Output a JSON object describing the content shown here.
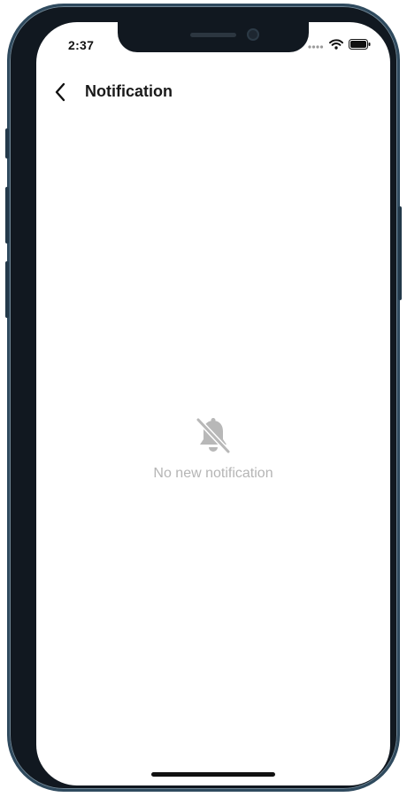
{
  "status_bar": {
    "time": "2:37",
    "icons": [
      "signal-icon",
      "wifi-icon",
      "battery-icon"
    ]
  },
  "header": {
    "back_icon": "chevron-left-icon",
    "title": "Notification"
  },
  "empty_state": {
    "icon": "bell-off-icon",
    "message": "No new notification"
  },
  "colors": {
    "frame": "#111820",
    "frame_edge": "#2f4a5e",
    "background": "#ffffff",
    "title": "#1a1a1a",
    "muted": "#b5b5b5"
  }
}
